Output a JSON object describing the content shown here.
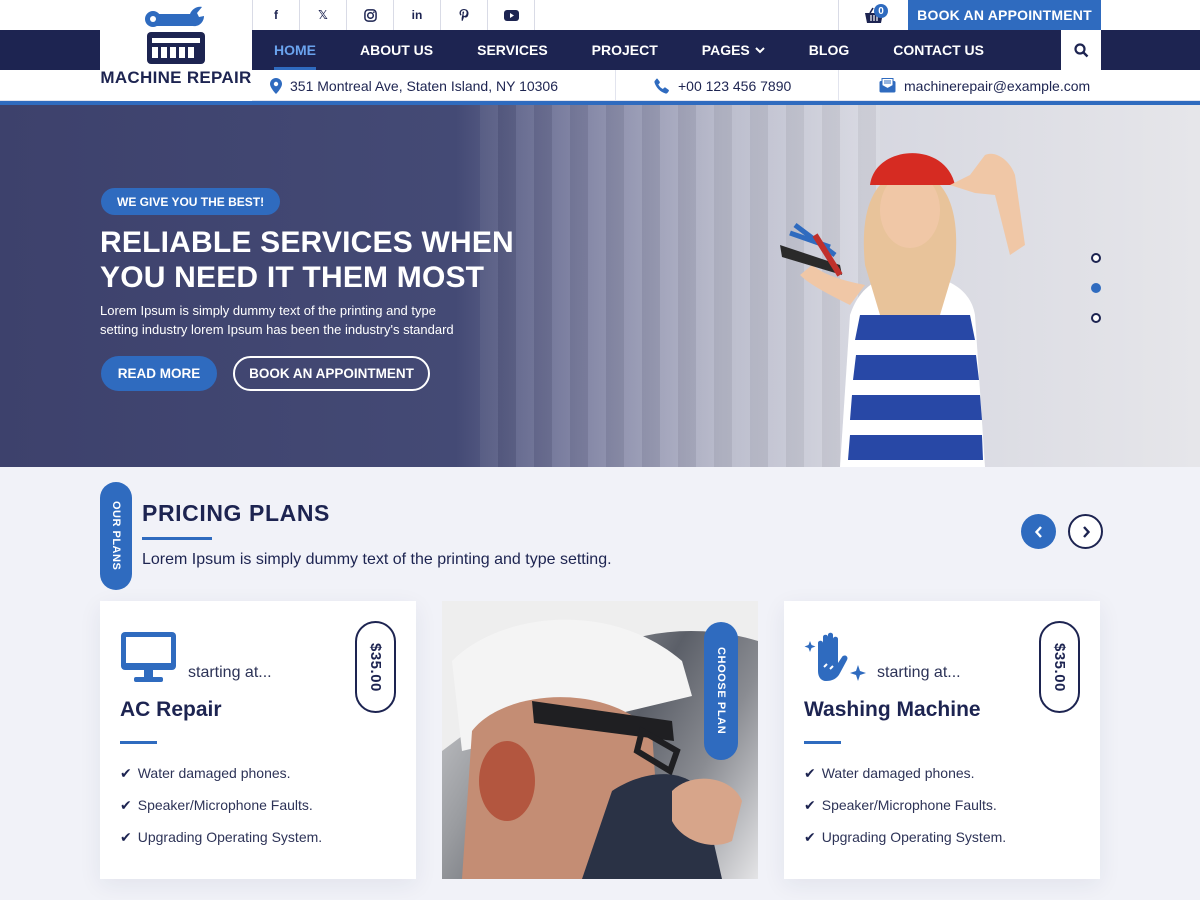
{
  "brand": {
    "name": "MACHINE REPAIR"
  },
  "social": [
    {
      "icon": "facebook-icon",
      "glyph": "f"
    },
    {
      "icon": "x-twitter-icon",
      "glyph": "𝕏"
    },
    {
      "icon": "instagram-icon",
      "glyph": "◎"
    },
    {
      "icon": "linkedin-icon",
      "glyph": "in"
    },
    {
      "icon": "pinterest-icon",
      "glyph": "P"
    },
    {
      "icon": "youtube-icon",
      "glyph": "▶"
    }
  ],
  "cart": {
    "count": "0"
  },
  "header": {
    "book_label": "BOOK AN APPOINTMENT"
  },
  "nav": {
    "items": [
      "HOME",
      "ABOUT US",
      "SERVICES",
      "PROJECT",
      "PAGES",
      "BLOG",
      "CONTACT US"
    ],
    "active": "HOME"
  },
  "contact": {
    "address": "351 Montreal Ave, Staten Island, NY 10306",
    "phone": "+00 123 456 7890",
    "email": "machinerepair@example.com"
  },
  "hero": {
    "tagline": "WE GIVE YOU THE BEST!",
    "title_line1": "RELIABLE SERVICES WHEN",
    "title_line2": "YOU NEED IT THEM MOST",
    "lead_line1": "Lorem Ipsum is simply dummy text of the printing and type",
    "lead_line2": "setting industry lorem Ipsum has been the industry's standard",
    "read_more": "READ MORE",
    "book": "BOOK AN APPOINTMENT",
    "slides": 3,
    "active_slide": 2
  },
  "pricing": {
    "pill": "OUR PLANS",
    "title": "PRICING PLANS",
    "subtitle": "Lorem Ipsum is simply dummy text of the printing and type setting.",
    "choose_label": "CHOOSE PLAN",
    "plans": [
      {
        "icon": "monitor-icon",
        "starting": "starting at...",
        "price": "$35.00",
        "name": "AC Repair",
        "features": [
          "Water damaged phones.",
          "Speaker/Microphone Faults.",
          "Upgrading Operating System."
        ]
      },
      {
        "icon": "clean-hand-icon",
        "starting": "starting at...",
        "price": "$35.00",
        "name": "Washing Machine",
        "features": [
          "Water damaged phones.",
          "Speaker/Microphone Faults.",
          "Upgrading Operating System."
        ]
      }
    ]
  },
  "colors": {
    "navy": "#1d2451",
    "accent": "#2f6bbf",
    "background": "#f1f2f8"
  }
}
